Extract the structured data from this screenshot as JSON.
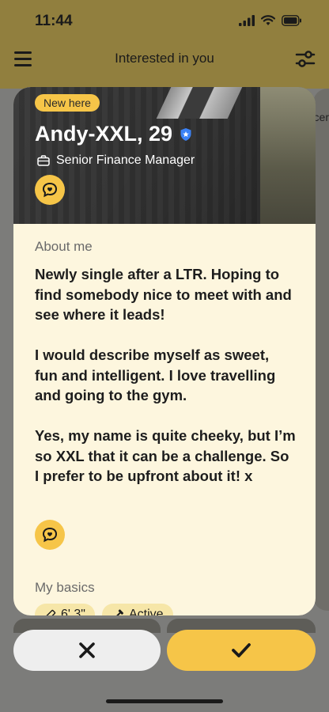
{
  "status_bar": {
    "time": "11:44"
  },
  "header": {
    "title": "Interested in you"
  },
  "peek": {
    "text": "cer"
  },
  "profile": {
    "badge": "New here",
    "name_age": "Andy-XXL, 29",
    "job": "Senior Finance Manager",
    "about_label": "About me",
    "about_text": "Newly single after a LTR. Hoping to find somebody nice to meet with and see where it leads!\n\nI would describe myself as sweet, fun and intelligent. I love travelling and going to the gym.\n\nYes, my name is quite cheeky, but I’m so XXL that it can be a challenge. So I prefer to be upfront about it! x",
    "basics_label": "My basics",
    "basics": [
      {
        "icon": "ruler-icon",
        "label": "6' 3\""
      },
      {
        "icon": "dumbbell-icon",
        "label": "Active"
      }
    ]
  },
  "colors": {
    "accent": "#f6c548",
    "card_bg": "#fdf6de",
    "chip_bg": "#f6e6a8",
    "verified": "#3b82f6"
  }
}
